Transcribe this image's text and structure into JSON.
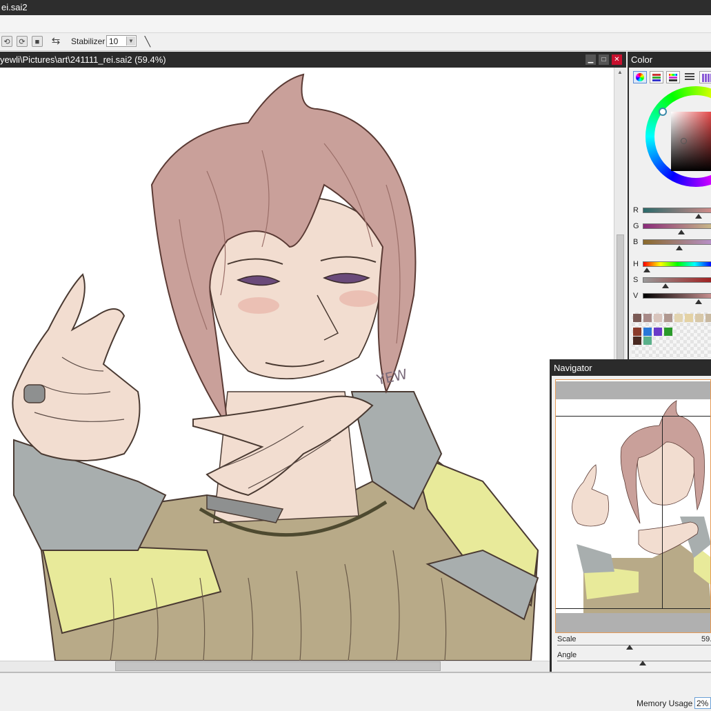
{
  "window": {
    "title": "ei.sai2"
  },
  "toolbar": {
    "stabilizer_label": "Stabilizer",
    "stabilizer_value": "10"
  },
  "document": {
    "title": "yewli\\Pictures\\art\\241111_rei.sai2 (59.4%)",
    "signature": "YEW"
  },
  "color_panel": {
    "title": "Color",
    "sliders": {
      "r": {
        "label": "R",
        "value": 0.79
      },
      "g": {
        "label": "G",
        "value": 0.55
      },
      "b": {
        "label": "B",
        "value": 0.52
      },
      "h": {
        "label": "H",
        "value": 0.05
      },
      "s": {
        "label": "S",
        "value": 0.32
      },
      "v": {
        "label": "V",
        "value": 0.79
      }
    },
    "swatches_row1": [
      "#7a5a55",
      "#a88a88",
      "#d8c4bc",
      "#b09890",
      "#e2d4b0",
      "#e4d2a4",
      "#d8c8a8",
      "#c8b8a0",
      "#a89a8a"
    ],
    "swatches_row2": [
      "#8a3a2a",
      "#2a78d8",
      "#6a3ac8",
      "#2a9a2a"
    ],
    "swatches_row3": [
      "#4a2a22",
      "#5ab08a"
    ]
  },
  "navigator": {
    "title": "Navigator",
    "scale_label": "Scale",
    "scale_value": "59.",
    "angle_label": "Angle",
    "scale_level": 0.55,
    "angle_level": 0.6
  },
  "status": {
    "memory_label": "Memory Usage",
    "memory_value": "2%"
  },
  "colors": {
    "hair": "#c9a09a",
    "skin": "#f2ddd0",
    "sweater": "#b8aa88",
    "yellow": "#e8ea9a",
    "grey": "#a8aeae",
    "accent": "#e69a55"
  }
}
